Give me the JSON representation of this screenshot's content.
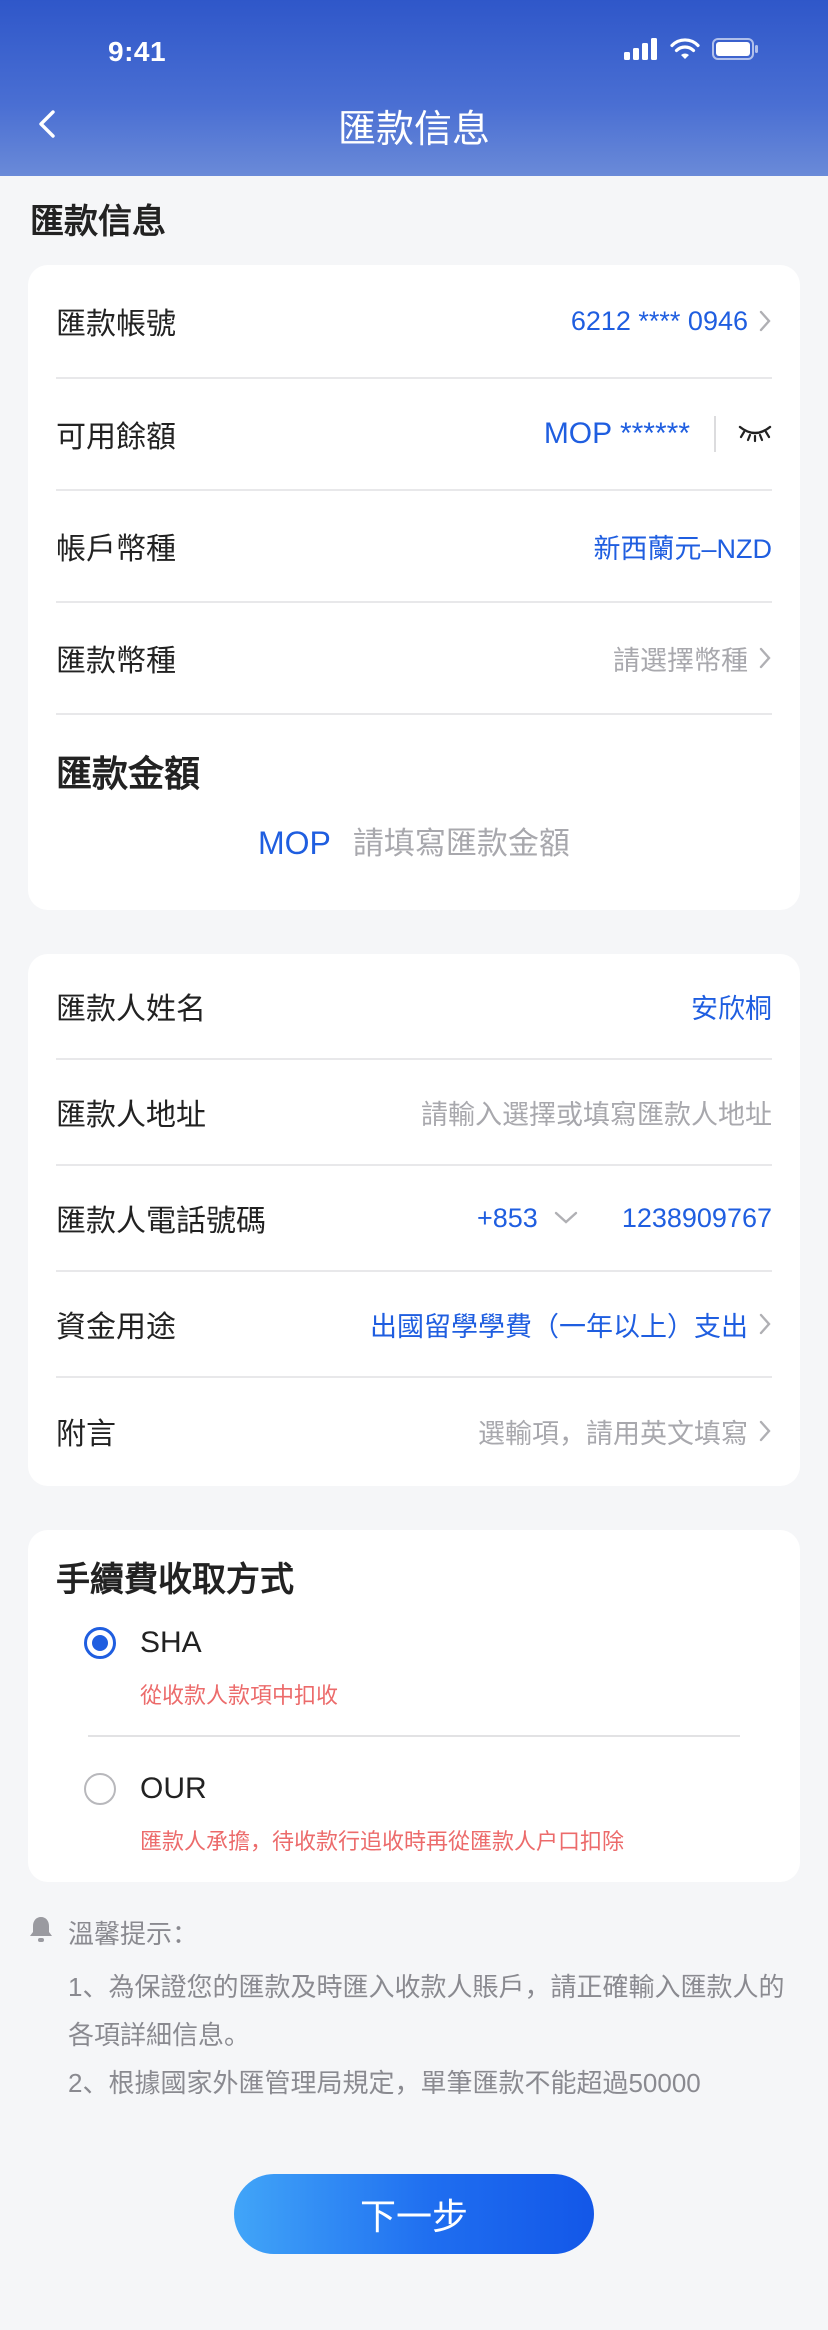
{
  "status_bar": {
    "time": "9:41"
  },
  "nav": {
    "title": "匯款信息"
  },
  "section": {
    "title": "匯款信息"
  },
  "account_card": {
    "rows": [
      {
        "label": "匯款帳號",
        "value": "6212 **** 0946"
      },
      {
        "label": "可用餘額",
        "value": "MOP ******"
      },
      {
        "label": "帳戶幣種",
        "value": "新西蘭元–NZD"
      },
      {
        "label": "匯款幣種",
        "value": "請選擇幣種"
      }
    ],
    "amount_label": "匯款金額",
    "amount_currency": "MOP",
    "amount_placeholder": "請填寫匯款金額"
  },
  "remitter_card": {
    "rows": [
      {
        "label": "匯款人姓名",
        "value": "安欣桐"
      },
      {
        "label": "匯款人地址",
        "value": "請輸入選擇或填寫匯款人地址"
      },
      {
        "label": "匯款人電話號碼",
        "country_code": "+853",
        "value": "1238909767"
      },
      {
        "label": "資金用途",
        "value": "出國留學學費（一年以上）支出"
      },
      {
        "label": "附言",
        "value": "選輸項，請用英文填寫"
      }
    ]
  },
  "fee_card": {
    "title": "手續費收取方式",
    "options": [
      {
        "label": "SHA",
        "desc": "從收款人款項中扣收",
        "selected": true
      },
      {
        "label": "OUR",
        "desc": "匯款人承擔，待收款行追收時再從匯款人户口扣除",
        "selected": false
      }
    ]
  },
  "tips": {
    "title": "溫馨提示：",
    "lines": [
      "1、為保證您的匯款及時匯入收款人賬戶，請正確輸入匯款人的各項詳細信息。",
      "2、根據國家外匯管理局規定，單筆匯款不能超過50000"
    ]
  },
  "actions": {
    "next_label": "下一步"
  },
  "colors": {
    "primary": "#1f5ee0",
    "header": "#3a60cc",
    "warning": "#ec6b6b",
    "placeholder": "#a8a8ad"
  }
}
